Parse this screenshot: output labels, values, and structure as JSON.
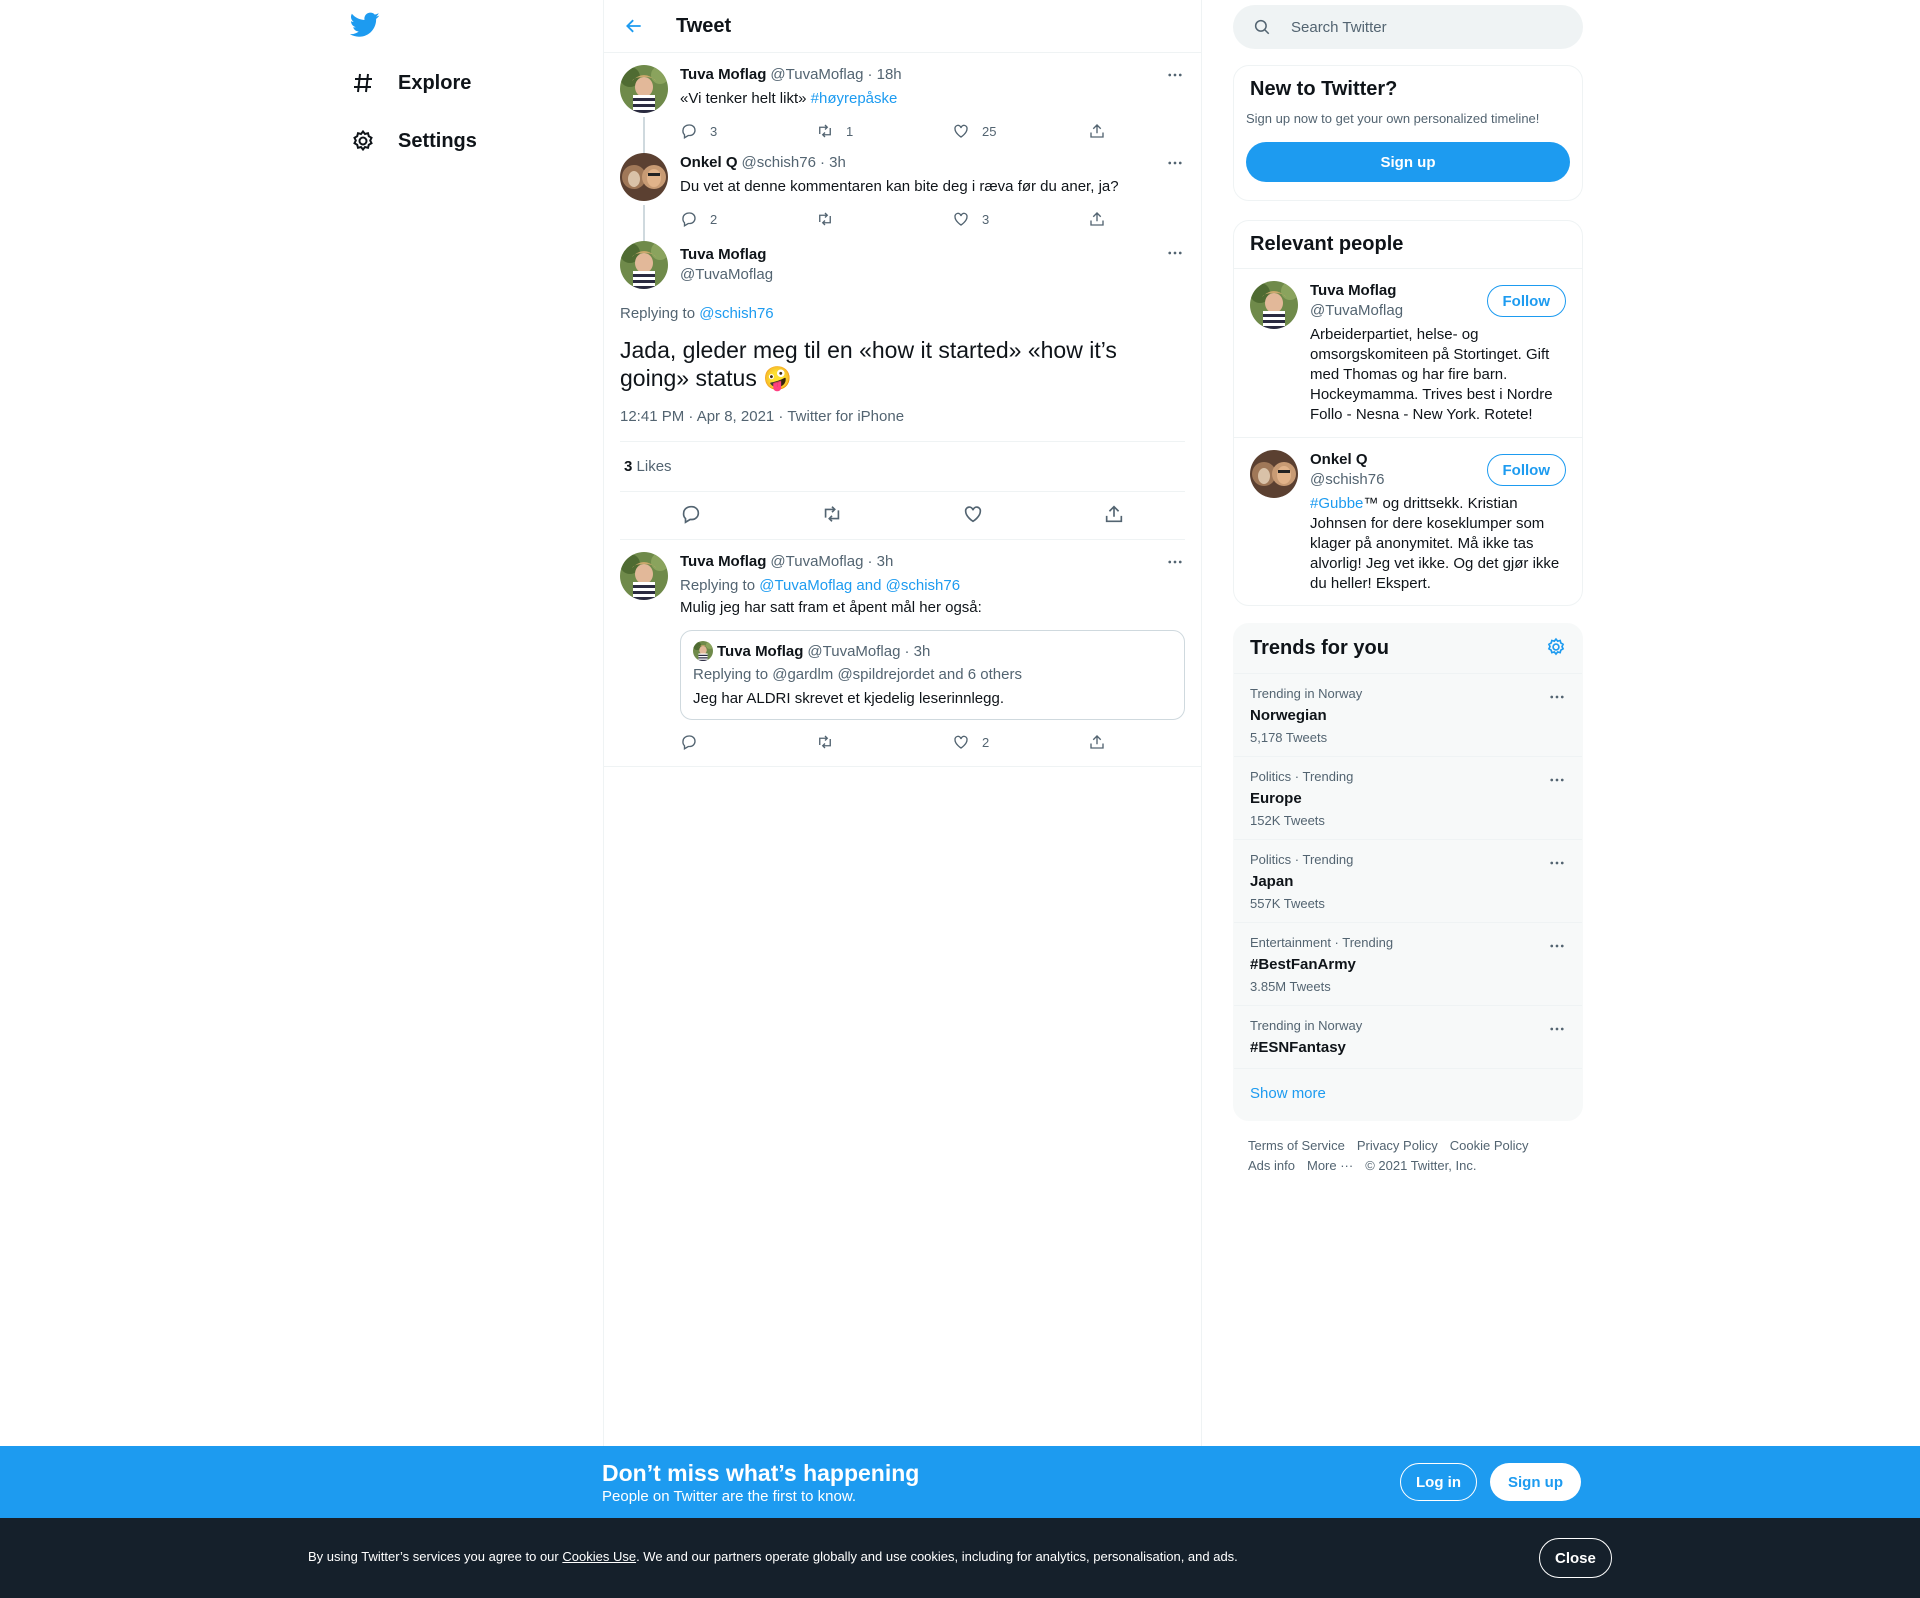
{
  "nav": {
    "explore": "Explore",
    "settings": "Settings"
  },
  "header": {
    "title": "Tweet"
  },
  "thread": [
    {
      "name": "Tuva Moflag",
      "handle": "@TuvaMoflag",
      "time": "· 18h",
      "text_before": "«Vi tenker helt likt» ",
      "hashtag": "#høyrepåske",
      "replies": "3",
      "retweets": "1",
      "likes": "25"
    },
    {
      "name": "Onkel Q",
      "handle": "@schish76",
      "time": "· 3h",
      "text": "Du vet at denne kommentaren kan bite deg i ræva før du aner, ja?",
      "replies": "2",
      "retweets": "",
      "likes": "3"
    }
  ],
  "main_tweet": {
    "name": "Tuva Moflag",
    "handle": "@TuvaMoflag",
    "replying_label": "Replying to",
    "replying_to": "@schish76",
    "text": "Jada, gleder meg til en «how it started» «how it’s going» status 🤪",
    "meta": "12:41 PM · Apr 8, 2021 · Twitter for iPhone",
    "likes_count": "3",
    "likes_label": "Likes"
  },
  "reply": {
    "name": "Tuva Moflag",
    "handle": "@TuvaMoflag",
    "time": "· 3h",
    "replying_label": "Replying to",
    "replying_to": "@TuvaMoflag and @schish76",
    "text": "Mulig jeg har satt fram et åpent mål her også:",
    "quote": {
      "name": "Tuva Moflag",
      "handle": "@TuvaMoflag",
      "time": "· 3h",
      "replying": "Replying to @gardlm @spildrejordet and 6 others",
      "text": "Jeg har ALDRI skrevet et kjedelig leserinnlegg."
    },
    "replies": "",
    "retweets": "",
    "likes": "2"
  },
  "search": {
    "placeholder": "Search Twitter"
  },
  "new_to_twitter": {
    "title": "New to Twitter?",
    "subtitle": "Sign up now to get your own personalized timeline!",
    "button": "Sign up"
  },
  "relevant_people": {
    "title": "Relevant people",
    "people": [
      {
        "name": "Tuva Moflag",
        "handle": "@TuvaMoflag",
        "bio": "Arbeiderpartiet, helse- og omsorgskomiteen på Stortinget. Gift med Thomas og har fire barn. Hockeymamma. Trives best i Nordre Follo - Nesna - New York. Rotete!",
        "follow": "Follow"
      },
      {
        "name": "Onkel Q",
        "handle": "@schish76",
        "bio_tag": "#Gubbe",
        "bio": "™ og drittsekk. Kristian Johnsen for dere koseklumper som klager på anonymitet. Må ikke tas alvorlig! Jeg vet ikke. Og det gjør ikke du heller! Ekspert.",
        "follow": "Follow"
      }
    ]
  },
  "trends": {
    "title": "Trends for you",
    "items": [
      {
        "context": "Trending in Norway",
        "name": "Norwegian",
        "count": "5,178 Tweets"
      },
      {
        "context": "Politics · Trending",
        "name": "Europe",
        "count": "152K Tweets"
      },
      {
        "context": "Politics · Trending",
        "name": "Japan",
        "count": "557K Tweets"
      },
      {
        "context": "Entertainment · Trending",
        "name": "#BestFanArmy",
        "count": "3.85M Tweets"
      },
      {
        "context": "Trending in Norway",
        "name": "#ESNFantasy",
        "count": ""
      }
    ],
    "show_more": "Show more"
  },
  "footer": {
    "terms": "Terms of Service",
    "privacy": "Privacy Policy",
    "cookie": "Cookie Policy",
    "ads": "Ads info",
    "more": "More ···",
    "copyright": "© 2021 Twitter, Inc."
  },
  "bottom_banner": {
    "title": "Don’t miss what’s happening",
    "subtitle": "People on Twitter are the first to know.",
    "login": "Log in",
    "signup": "Sign up"
  },
  "cookie_bar": {
    "text_before": "By using Twitter’s services you agree to our ",
    "link": "Cookies Use",
    "text_after": ". We and our partners operate globally and use cookies, including for analytics, personalisation, and ads.",
    "close": "Close"
  },
  "colors": {
    "accent": "#1d9bf0",
    "dark": "#15202b"
  }
}
